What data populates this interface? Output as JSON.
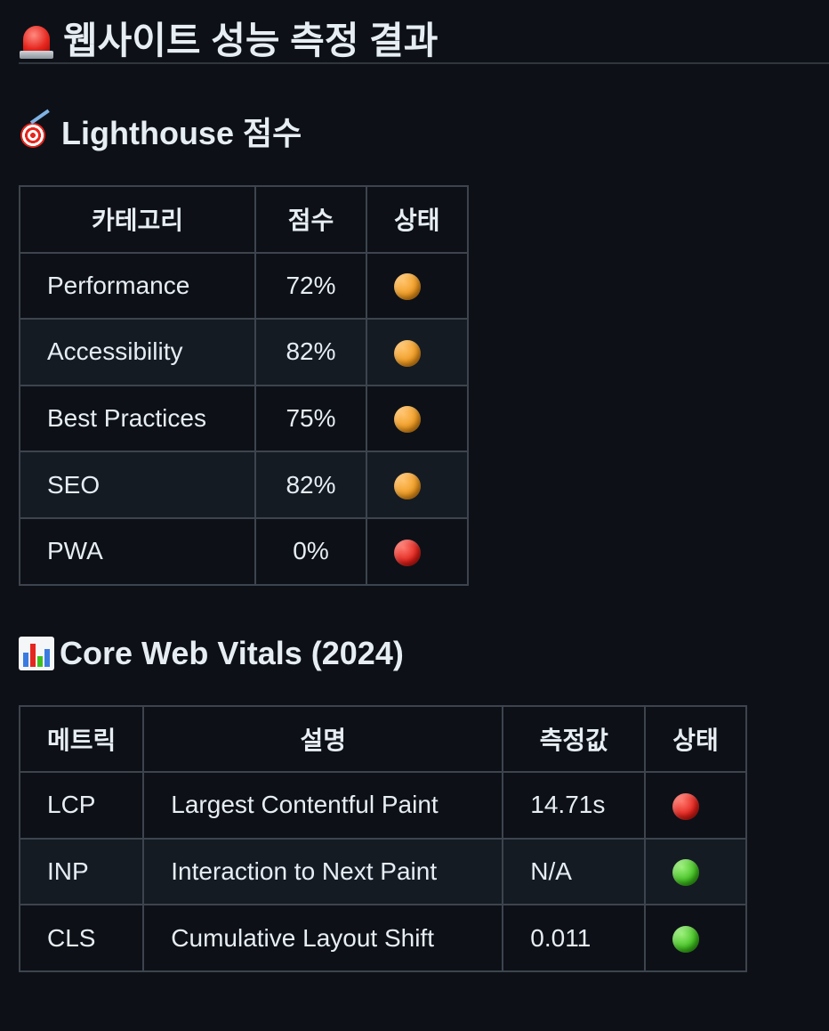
{
  "page_title": "웹사이트 성능 측정 결과",
  "page_title_icon": "siren-icon",
  "lighthouse": {
    "heading": "Lighthouse 점수",
    "heading_icon": "target-icon",
    "columns": [
      "카테고리",
      "점수",
      "상태"
    ],
    "rows": [
      {
        "category": "Performance",
        "score": "72%",
        "status": "orange"
      },
      {
        "category": "Accessibility",
        "score": "82%",
        "status": "orange"
      },
      {
        "category": "Best Practices",
        "score": "75%",
        "status": "orange"
      },
      {
        "category": "SEO",
        "score": "82%",
        "status": "orange"
      },
      {
        "category": "PWA",
        "score": "0%",
        "status": "red"
      }
    ]
  },
  "web_vitals": {
    "heading": "Core Web Vitals (2024)",
    "heading_icon": "bar-chart-icon",
    "columns": [
      "메트릭",
      "설명",
      "측정값",
      "상태"
    ],
    "rows": [
      {
        "metric": "LCP",
        "description": "Largest Contentful Paint",
        "value": "14.71s",
        "status": "red"
      },
      {
        "metric": "INP",
        "description": "Interaction to Next Paint",
        "value": "N/A",
        "status": "green"
      },
      {
        "metric": "CLS",
        "description": "Cumulative Layout Shift",
        "value": "0.011",
        "status": "green"
      }
    ]
  },
  "status_colors": {
    "orange": "#ef9a1f",
    "red": "#e0201a",
    "green": "#3fbf1f"
  }
}
